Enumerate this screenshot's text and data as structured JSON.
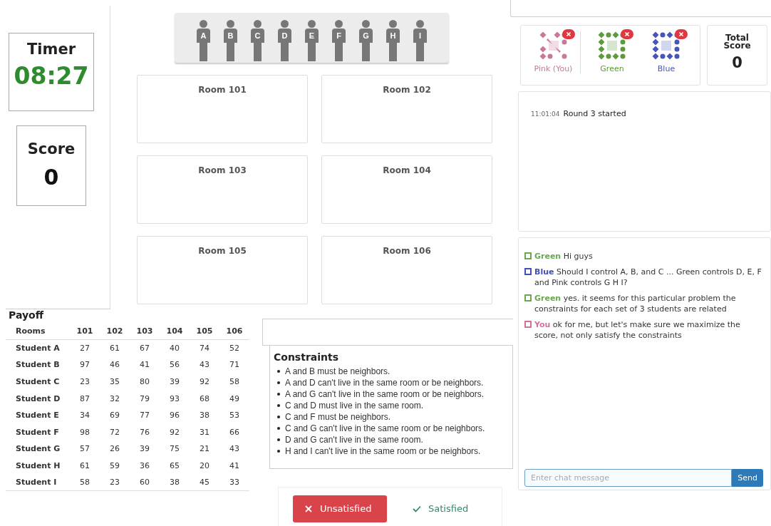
{
  "timer": {
    "label": "Timer",
    "value": "08:27"
  },
  "score": {
    "label": "Score",
    "value": "0"
  },
  "students": [
    {
      "letter": "A"
    },
    {
      "letter": "B"
    },
    {
      "letter": "C"
    },
    {
      "letter": "D"
    },
    {
      "letter": "E"
    },
    {
      "letter": "F"
    },
    {
      "letter": "G"
    },
    {
      "letter": "H"
    },
    {
      "letter": "I"
    }
  ],
  "rooms": [
    {
      "name": "Room 101"
    },
    {
      "name": "Room 102"
    },
    {
      "name": "Room 103"
    },
    {
      "name": "Room 104"
    },
    {
      "name": "Room 105"
    },
    {
      "name": "Room 106"
    }
  ],
  "players": [
    {
      "name": "Pink (You)",
      "color": "#c9789d"
    },
    {
      "name": "Green",
      "color": "#5e9a3c"
    },
    {
      "name": "Blue",
      "color": "#4656b8"
    }
  ],
  "total_score": {
    "label": "Total Score",
    "value": "0"
  },
  "log": [
    {
      "time": "11:01:04",
      "text": "Round 3 started"
    }
  ],
  "chat": {
    "messages": [
      {
        "sender": "Green",
        "color": "#6aa84f",
        "text": "Hi guys"
      },
      {
        "sender": "Blue",
        "color": "#3f51b5",
        "text": "Should I control A, B, and C ... Green controls D, E, F and Pink controls G H I?"
      },
      {
        "sender": "Green",
        "color": "#6aa84f",
        "text": "yes. it seems for this particular problem the constraints for each set of 3 students are related"
      },
      {
        "sender": "You",
        "color": "#d0739b",
        "text": "ok for me, but let's make sure we maximize the score, not only satisfy the constraints"
      }
    ],
    "input": {
      "placeholder": "Enter chat message"
    },
    "send_button": "Send"
  },
  "payoff": {
    "title": "Payoff",
    "columns": [
      "Rooms",
      "101",
      "102",
      "103",
      "104",
      "105",
      "106"
    ],
    "rows": [
      [
        "Student A",
        "27",
        "61",
        "67",
        "40",
        "74",
        "52"
      ],
      [
        "Student B",
        "97",
        "46",
        "41",
        "56",
        "43",
        "71"
      ],
      [
        "Student C",
        "23",
        "35",
        "80",
        "39",
        "92",
        "58"
      ],
      [
        "Student D",
        "87",
        "32",
        "79",
        "93",
        "68",
        "49"
      ],
      [
        "Student E",
        "34",
        "69",
        "77",
        "96",
        "38",
        "53"
      ],
      [
        "Student F",
        "98",
        "72",
        "76",
        "92",
        "31",
        "66"
      ],
      [
        "Student G",
        "57",
        "26",
        "39",
        "75",
        "21",
        "43"
      ],
      [
        "Student H",
        "61",
        "59",
        "36",
        "65",
        "20",
        "41"
      ],
      [
        "Student I",
        "58",
        "23",
        "60",
        "38",
        "45",
        "33"
      ]
    ]
  },
  "constraints": {
    "title": "Constraints",
    "items": [
      "A and B must be neighbors.",
      "A and D can't live in the same room or be neighbors.",
      "A and G can't live in the same room or be neighbors.",
      "C and D must live in the same room.",
      "C and F must be neighbors.",
      "C and G can't live in the same room or be neighbors.",
      "D and G can't live in the same room.",
      "H and I can't live in the same room or be neighbors."
    ]
  },
  "status_buttons": [
    {
      "kind": "unsatisfied",
      "label": "Unsatisfied",
      "selected": true
    },
    {
      "kind": "satisfied",
      "label": "Satisfied",
      "selected": false
    }
  ]
}
